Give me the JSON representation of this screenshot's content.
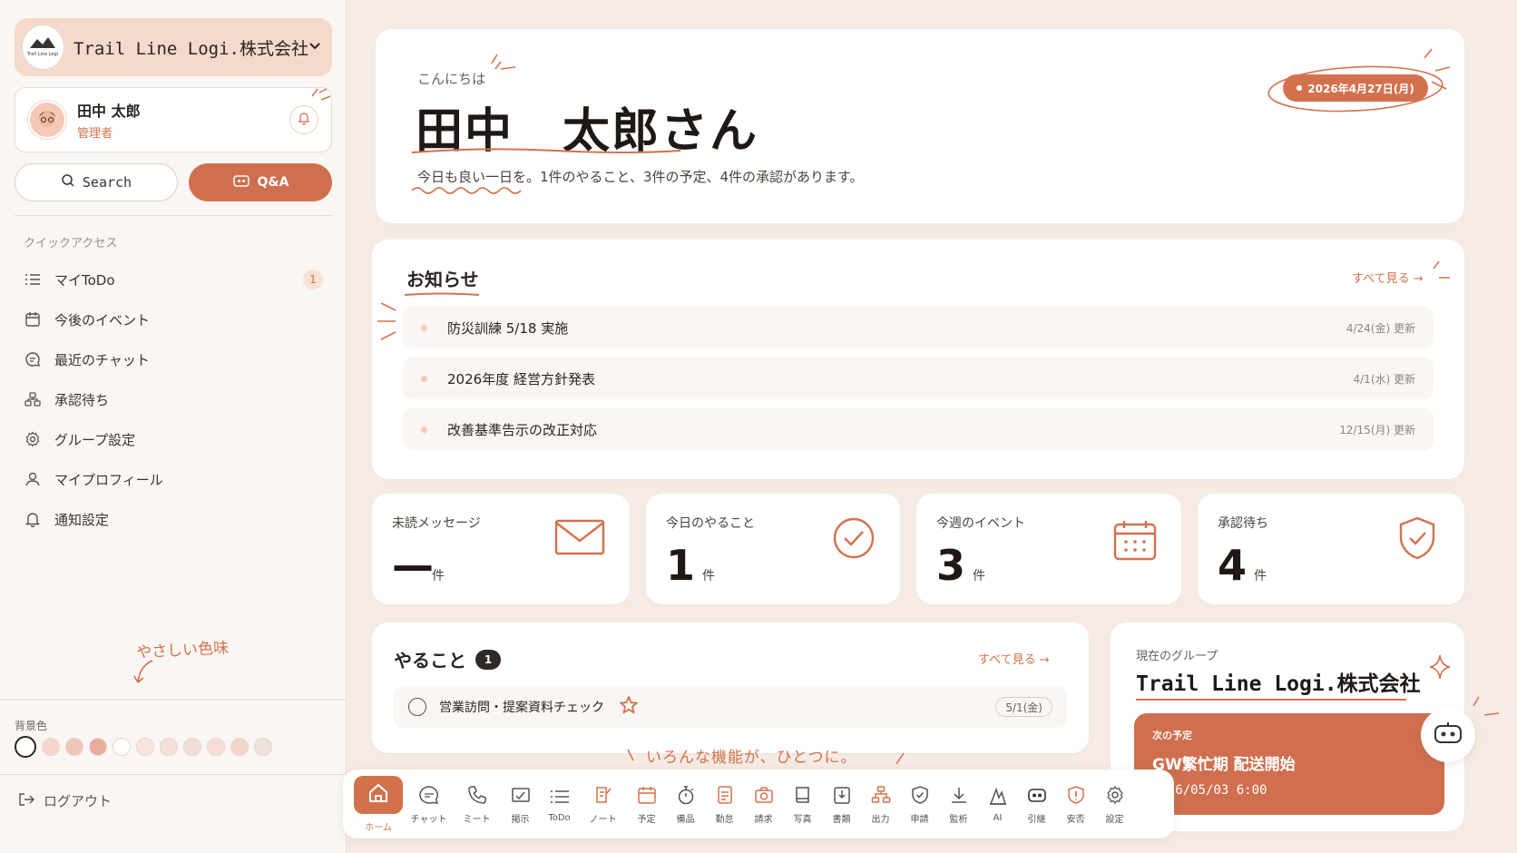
{
  "sidebar": {
    "company_name": "Trail Line Logi.株式会社",
    "logo_text": "Trail Line Logi",
    "user": {
      "name": "田中 太郎",
      "role": "管理者"
    },
    "search_label": "Search",
    "qa_label": "Q&A",
    "quick_access_title": "クイックアクセス",
    "menu": [
      {
        "label": "マイToDo",
        "icon": "list-icon",
        "badge": "1"
      },
      {
        "label": "今後のイベント",
        "icon": "calendar-icon"
      },
      {
        "label": "最近のチャット",
        "icon": "chat-icon"
      },
      {
        "label": "承認待ち",
        "icon": "approval-icon"
      },
      {
        "label": "グループ設定",
        "icon": "gear-icon"
      },
      {
        "label": "マイプロフィール",
        "icon": "user-icon"
      },
      {
        "label": "通知設定",
        "icon": "bell-icon"
      }
    ],
    "handwritten_note": "やさしい色味",
    "background_label": "背景色",
    "swatches": [
      "#ffffff",
      "#f7d7cb",
      "#efc6b7",
      "#e6ad9a",
      "#ffffff",
      "#f9e4dc",
      "#f3e2da",
      "#f1dfd6",
      "#f4e0d8",
      "#f3d5c9",
      "#efe3dd"
    ],
    "logout_label": "ログアウト"
  },
  "greeting": {
    "hello": "こんにちは",
    "name": "田中　太郎さん",
    "message": "今日も良い一日を。1件のやること、3件の予定、4件の承認があります。",
    "date": "2026年4月27日(月)"
  },
  "news": {
    "title": "お知らせ",
    "see_all": "すべて見る →",
    "items": [
      {
        "title": "防災訓練 5/18 実施",
        "date": "4/24(金) 更新"
      },
      {
        "title": "2026年度 経営方針発表",
        "date": "4/1(水) 更新"
      },
      {
        "title": "改善基準告示の改正対応",
        "date": "12/15(月) 更新"
      }
    ]
  },
  "stats": [
    {
      "label": "未読メッセージ",
      "value": "—",
      "unit": "件",
      "icon": "mail-icon"
    },
    {
      "label": "今日のやること",
      "value": "1",
      "unit": "件",
      "icon": "check-circle-icon"
    },
    {
      "label": "今週のイベント",
      "value": "3",
      "unit": "件",
      "icon": "calendar-icon"
    },
    {
      "label": "承認待ち",
      "value": "4",
      "unit": "件",
      "icon": "shield-check-icon"
    }
  ],
  "todo": {
    "title": "やること",
    "count": "1",
    "see_all": "すべて見る →",
    "items": [
      {
        "title": "営業訪問・提案資料チェック",
        "date": "5/1(金)"
      }
    ]
  },
  "group": {
    "label": "現在のグループ",
    "name": "Trail Line Logi.株式会社",
    "next_label": "次の予定",
    "next_title": "GW繁忙期 配送開始",
    "next_time": "2026/05/03 6:00"
  },
  "handwritten_features": "いろんな機能が、ひとつに。",
  "dock": [
    {
      "label": "ホーム",
      "icon": "home-icon"
    },
    {
      "label": "チャット",
      "icon": "chat-icon"
    },
    {
      "label": "ミート",
      "icon": "phone-icon"
    },
    {
      "label": "掲示",
      "icon": "board-icon"
    },
    {
      "label": "ToDo",
      "icon": "list-icon"
    },
    {
      "label": "ノート",
      "icon": "note-icon"
    },
    {
      "label": "予定",
      "icon": "calendar-icon"
    },
    {
      "label": "備品",
      "icon": "stopwatch-icon"
    },
    {
      "label": "勤怠",
      "icon": "attendance-icon"
    },
    {
      "label": "請求",
      "icon": "camera-icon"
    },
    {
      "label": "写真",
      "icon": "book-icon"
    },
    {
      "label": "書類",
      "icon": "document-icon"
    },
    {
      "label": "出力",
      "icon": "org-icon"
    },
    {
      "label": "申請",
      "icon": "shield-icon"
    },
    {
      "label": "監析",
      "icon": "download-icon"
    },
    {
      "label": "AI",
      "icon": "ai-icon"
    },
    {
      "label": "引継",
      "icon": "robot-icon"
    },
    {
      "label": "安否",
      "icon": "alert-shield-icon"
    },
    {
      "label": "設定",
      "icon": "gear-icon"
    }
  ],
  "colors": {
    "accent": "#d4714d",
    "accent_dark": "#cf6f4f",
    "background": "#f6ebe4",
    "sidebar": "#faf6f3"
  }
}
